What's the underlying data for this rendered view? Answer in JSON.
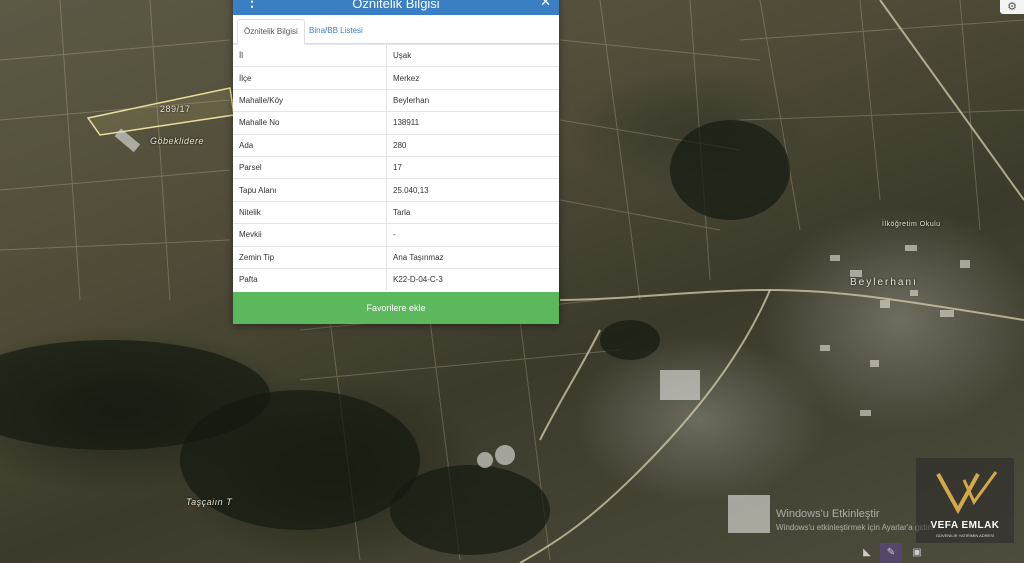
{
  "map": {
    "labels": [
      "289/17",
      "Göbekliderе",
      "Beylerhanı",
      "İlköğretim Okulu",
      "Taşçaiın T"
    ],
    "settings_icon": "gear-icon"
  },
  "panel": {
    "title": "Öznitelik Bilgisi",
    "menu_icon": "vertical-dots-icon",
    "close_icon": "close-icon",
    "tabs": [
      {
        "label": "Öznitelik Bilgisi",
        "active": true
      },
      {
        "label": "Bina/BB Listesi",
        "active": false
      }
    ],
    "rows": [
      {
        "key": "İl",
        "value": "Uşak"
      },
      {
        "key": "İlçe",
        "value": "Merkez"
      },
      {
        "key": "Mahalle/Köy",
        "value": "Beylerhan"
      },
      {
        "key": "Mahalle No",
        "value": "138911"
      },
      {
        "key": "Ada",
        "value": "280"
      },
      {
        "key": "Parsel",
        "value": "17"
      },
      {
        "key": "Tapu Alanı",
        "value": "25.040,13"
      },
      {
        "key": "Nitelik",
        "value": "Tarla"
      },
      {
        "key": "Mevkii",
        "value": "-"
      },
      {
        "key": "Zemin Tip",
        "value": "Ana Taşınmaz"
      },
      {
        "key": "Pafta",
        "value": "K22-D-04-C-3"
      }
    ],
    "favorite_button": "Favorilere ekle"
  },
  "overlay": {
    "activation_line1": "Windows'u Etkinleştir",
    "activation_line2": "Windows'u etkinleştirmek için Ayarlar'a gidin.",
    "logo_name": "VEFA EMLAK",
    "logo_tagline": "GÜVENİLİR YATIRIMIN ADRESİ"
  },
  "colors": {
    "header": "#3a7fc4",
    "button": "#5cb85c",
    "tab_link": "#3a7fc4"
  }
}
